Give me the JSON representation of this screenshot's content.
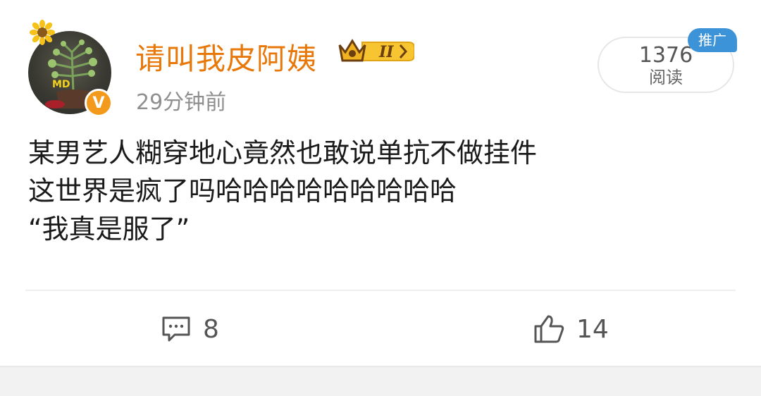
{
  "post": {
    "username": "请叫我皮阿姨",
    "time": "29分钟前",
    "reads": {
      "count": "1376",
      "label": "阅读"
    },
    "promo_tag": "推广",
    "member_level": "II",
    "avatar_text": "MD",
    "verified_mark": "V",
    "lines": [
      "某男艺人糊穿地心竟然也敢说单抗不做挂件",
      "这世界是疯了吗哈哈哈哈哈哈哈哈哈",
      "“我真是服了”"
    ]
  },
  "actions": {
    "comment_count": "8",
    "like_count": "14"
  },
  "icons": {
    "comment": "comment-icon",
    "like": "thumbs-up-icon",
    "crown": "crown-badge-icon",
    "sunflower": "sunflower-icon",
    "verified": "verified-v-icon"
  },
  "colors": {
    "username": "#e8780a",
    "promo_tag": "#3d93d8",
    "verified_badge": "#f39a1c"
  }
}
